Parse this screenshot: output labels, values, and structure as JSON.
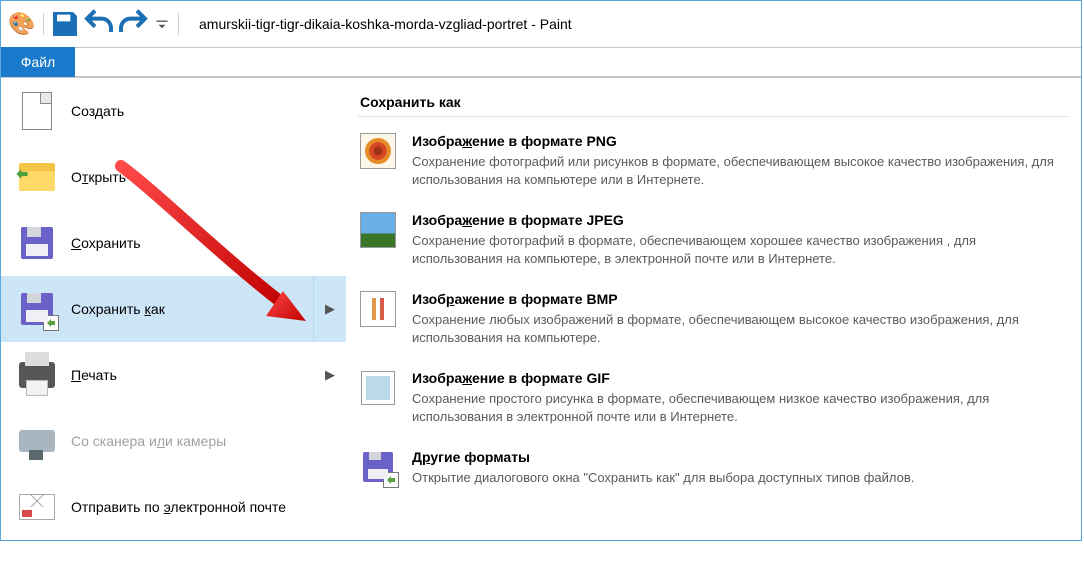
{
  "title": "amurskii-tigr-tigr-dikaia-koshka-morda-vzgliad-portret - Paint",
  "tabs": {
    "file": "Файл"
  },
  "menu": {
    "create": {
      "label": "Создать"
    },
    "open": {
      "label": "Открыть"
    },
    "save": {
      "label": "Сохранить"
    },
    "saveas": {
      "label": "Сохранить как"
    },
    "print": {
      "label": "Печать"
    },
    "scanner": {
      "label": "Со сканера или камеры"
    },
    "email": {
      "label": "Отправить по электронной почте"
    }
  },
  "panel": {
    "heading": "Сохранить как",
    "items": [
      {
        "title": "Изображение в формате PNG",
        "desc": "Сохранение фотографий или рисунков в формате, обеспечивающем высокое качество изображения, для использования на компьютере или в Интернете."
      },
      {
        "title": "Изображение в формате JPEG",
        "desc": "Сохранение фотографий в формате, обеспечивающем хорошее качество изображения , для использования на компьютере, в электронной почте или в Интернете."
      },
      {
        "title": "Изображение в формате BMP",
        "desc": "Сохранение любых изображений в формате, обеспечивающем высокое качество изображения, для использования на компьютере."
      },
      {
        "title": "Изображение в формате GIF",
        "desc": "Сохранение простого рисунка в формате, обеспечивающем низкое качество изображения, для использования в электронной почте или в Интернете."
      },
      {
        "title": "Другие форматы",
        "desc": "Открытие диалогового окна \"Сохранить как\" для выбора доступных типов файлов."
      }
    ]
  }
}
